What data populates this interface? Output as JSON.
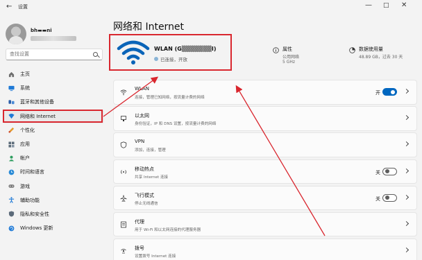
{
  "window": {
    "title": "设置",
    "back_icon": "back-arrow-icon",
    "minimize": "—",
    "maximize": "□",
    "close": "✕"
  },
  "user": {
    "name": "bh▬▬ni"
  },
  "search": {
    "placeholder": "查找设置"
  },
  "nav": [
    {
      "label": "主页",
      "icon": "home-icon"
    },
    {
      "label": "系统",
      "icon": "system-icon"
    },
    {
      "label": "蓝牙和其他设备",
      "icon": "bluetooth-icon"
    },
    {
      "label": "网络和 Internet",
      "icon": "network-icon",
      "active": true
    },
    {
      "label": "个性化",
      "icon": "brush-icon"
    },
    {
      "label": "应用",
      "icon": "apps-icon"
    },
    {
      "label": "帐户",
      "icon": "account-icon"
    },
    {
      "label": "时间和语言",
      "icon": "globe-clock-icon"
    },
    {
      "label": "游戏",
      "icon": "gamepad-icon"
    },
    {
      "label": "辅助功能",
      "icon": "accessibility-icon"
    },
    {
      "label": "隐私和安全性",
      "icon": "shield-icon"
    },
    {
      "label": "Windows 更新",
      "icon": "update-icon"
    }
  ],
  "page": {
    "title": "网络和 Internet"
  },
  "hero": {
    "network_name": "WLAN (G▒▒▒▒▒▒▒I)",
    "status": "已连接，开放",
    "properties": {
      "title": "属性",
      "line1": "公用网络",
      "line2": "5 GHz"
    },
    "data_usage": {
      "title": "数据使用量",
      "line1": "48.89 GB，过去 30 天"
    }
  },
  "cards": [
    {
      "title": "WLAN",
      "desc": "连接，管理已知网络，按流量计费的网络",
      "icon": "wifi-icon",
      "toggle_label": "开",
      "toggle_on": true
    },
    {
      "title": "以太网",
      "desc": "身份验证，IP 和 DNS 设置，按流量计费的网络",
      "icon": "ethernet-icon"
    },
    {
      "title": "VPN",
      "desc": "添加，连接，管理",
      "icon": "vpn-shield-icon"
    },
    {
      "title": "移动热点",
      "desc": "共享 Internet 连接",
      "icon": "hotspot-icon",
      "toggle_label": "关",
      "toggle_on": false
    },
    {
      "title": "飞行模式",
      "desc": "停止无线通信",
      "icon": "airplane-icon",
      "toggle_label": "关",
      "toggle_on": false
    },
    {
      "title": "代理",
      "desc": "用于 Wi-Fi 和以太网连接的代理服务器",
      "icon": "proxy-icon"
    },
    {
      "title": "拨号",
      "desc": "设置拨号 Internet 连接",
      "icon": "dialup-icon"
    }
  ],
  "colors": {
    "accent": "#0067c0",
    "annotation": "#d9262e",
    "wifi_blue": "#0a64b8"
  }
}
